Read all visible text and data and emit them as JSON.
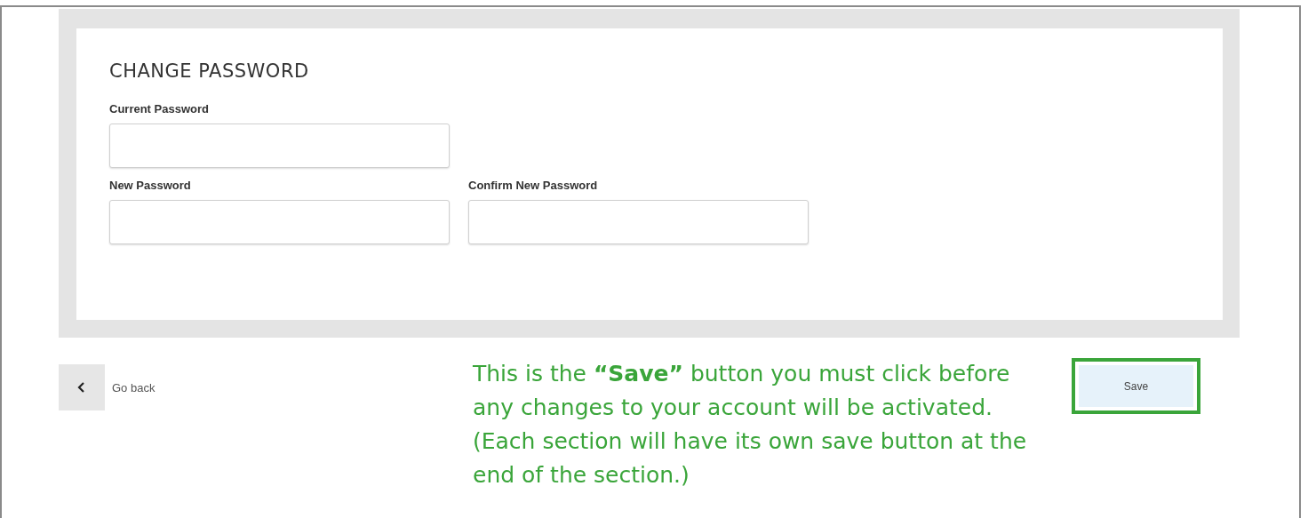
{
  "section": {
    "title": "CHANGE PASSWORD",
    "fields": [
      {
        "label": "Current Password"
      },
      {
        "label": "New Password"
      },
      {
        "label": "Confirm New Password"
      }
    ]
  },
  "back_button": {
    "label": "Go back"
  },
  "callout": {
    "text": "This is the **“Save”** button you must click before any changes to your account will be activated. (Each section will have its own save button at the end of the section.)"
  },
  "save_button": {
    "label": "Save",
    "highlighted": true
  }
}
